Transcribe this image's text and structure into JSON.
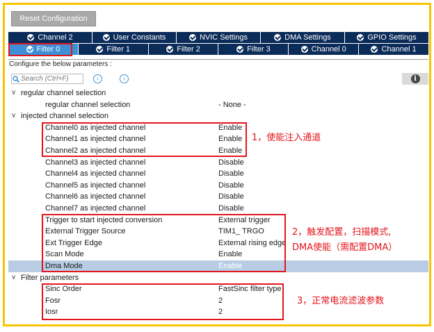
{
  "toolbar": {
    "reset_label": "Reset Configuration"
  },
  "tabs_row1": [
    {
      "label": "Channel 2"
    },
    {
      "label": "User Constants"
    },
    {
      "label": "NVIC Settings"
    },
    {
      "label": "DMA Settings"
    },
    {
      "label": "GPIO Settings"
    }
  ],
  "tabs_row2": [
    {
      "label": "Filter 0",
      "active": true
    },
    {
      "label": "Filter 1"
    },
    {
      "label": "Filter 2"
    },
    {
      "label": "Filter 3"
    },
    {
      "label": "Channel 0"
    },
    {
      "label": "Channel 1"
    }
  ],
  "hint": "Configure the below parameters :",
  "search": {
    "placeholder": "Search (Ctrl+F)"
  },
  "groups": {
    "regular": "regular channel selection",
    "injected": "injected channel selection",
    "filter": "Filter parameters"
  },
  "params": {
    "regular": [
      {
        "name": "regular channel selection",
        "value": "- None -"
      }
    ],
    "injected": [
      {
        "name": "Channel0 as injected channel",
        "value": "Enable"
      },
      {
        "name": "Channel1 as injected channel",
        "value": "Enable"
      },
      {
        "name": "Channel2 as injected channel",
        "value": "Enable"
      },
      {
        "name": "Channel3 as injected channel",
        "value": "Disable"
      },
      {
        "name": "Channel4 as injected channel",
        "value": "Disable"
      },
      {
        "name": "Channel5 as injected channel",
        "value": "Disable"
      },
      {
        "name": "Channel6 as injected channel",
        "value": "Disable"
      },
      {
        "name": "Channel7 as injected channel",
        "value": "Disable"
      },
      {
        "name": "Trigger to start injected conversion",
        "value": "External trigger"
      },
      {
        "name": "External Trigger Source",
        "value": "TIM1_ TRGO"
      },
      {
        "name": "Ext Trigger Edge",
        "value": "External rising edge"
      },
      {
        "name": "Scan Mode",
        "value": "Enable"
      },
      {
        "name": "Dma Mode",
        "value": "Enable"
      }
    ],
    "filter": [
      {
        "name": "Sinc Order",
        "value": "FastSinc filter type"
      },
      {
        "name": "Fosr",
        "value": "2"
      },
      {
        "name": "Iosr",
        "value": "2"
      }
    ]
  },
  "annotations": {
    "a1": "1，使能注入通道",
    "a2_line1": "2，触发配置，扫描模式,",
    "a2_line2": "DMA使能（需配置DMA）",
    "a3": "3，正常电流滤波参数"
  },
  "colors": {
    "tab_bg": "#0b2b59",
    "tab_active": "#3d8fd6",
    "frame_border": "#f7c400",
    "highlight_red": "#e3141b",
    "selected_row": "#b8cce4"
  }
}
